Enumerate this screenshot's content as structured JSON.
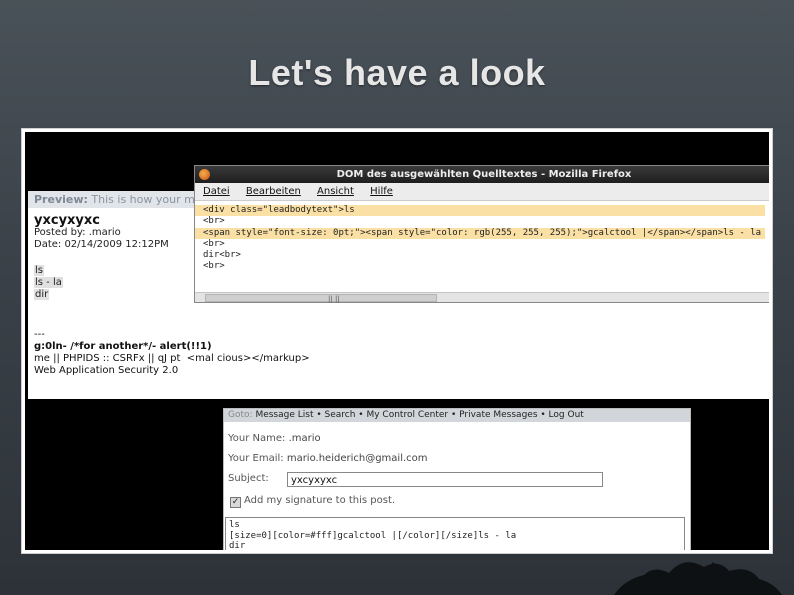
{
  "slide": {
    "title": "Let's have a look"
  },
  "blog": {
    "preview_label": "Preview:",
    "preview_text": "This is how your messa",
    "post_title": "yxcyxyxc",
    "posted_by": "Posted by: .mario",
    "date": "Date: 02/14/2009 12:12PM",
    "highlight_lines": [
      "ls",
      "ls - la",
      "dir"
    ],
    "sig_lines": [
      {
        "text": "---",
        "bold": false
      },
      {
        "text": "g:0ln- /*for another*/- alert(!!1)",
        "bold": true
      },
      {
        "text": "me || PHPIDS :: CSRFx || qJ pt   <mal cious></markup>",
        "bold": false
      },
      {
        "text": "Web Application Security 2.0",
        "bold": false
      }
    ]
  },
  "firefox": {
    "window_title": "DOM des ausgewählten Quelltextes - Mozilla Firefox",
    "menu": [
      "Datei",
      "Bearbeiten",
      "Ansicht",
      "Hilfe"
    ],
    "source_lines": [
      "<div class=\"leadbodytext\">ls",
      "<br>",
      "<span style=\"font-size: 0pt;\"><span style=\"color: rgb(255, 255, 255);\">gcalctool |</span></span>ls - la",
      "<br>",
      "dir<br>",
      "<br>"
    ],
    "scroll_mark": "|| ||"
  },
  "message_form": {
    "nav": {
      "goto": "Goto:",
      "items": [
        "Message List",
        "Search",
        "My Control Center",
        "Private Messages",
        "Log Out"
      ]
    },
    "your_name_label": "Your Name:",
    "your_name": ".mario",
    "your_email_label": "Your Email:",
    "your_email": "mario.heiderich@gmail.com",
    "subject_label": "Subject:",
    "subject_value": "yxcyxyxc",
    "signature_label": "Add my signature to this post.",
    "signature_checked": "✓",
    "body_lines": [
      "ls",
      "[size=0][color=#fff]gcalctool |[/color][/size]ls - la",
      "dir"
    ]
  }
}
